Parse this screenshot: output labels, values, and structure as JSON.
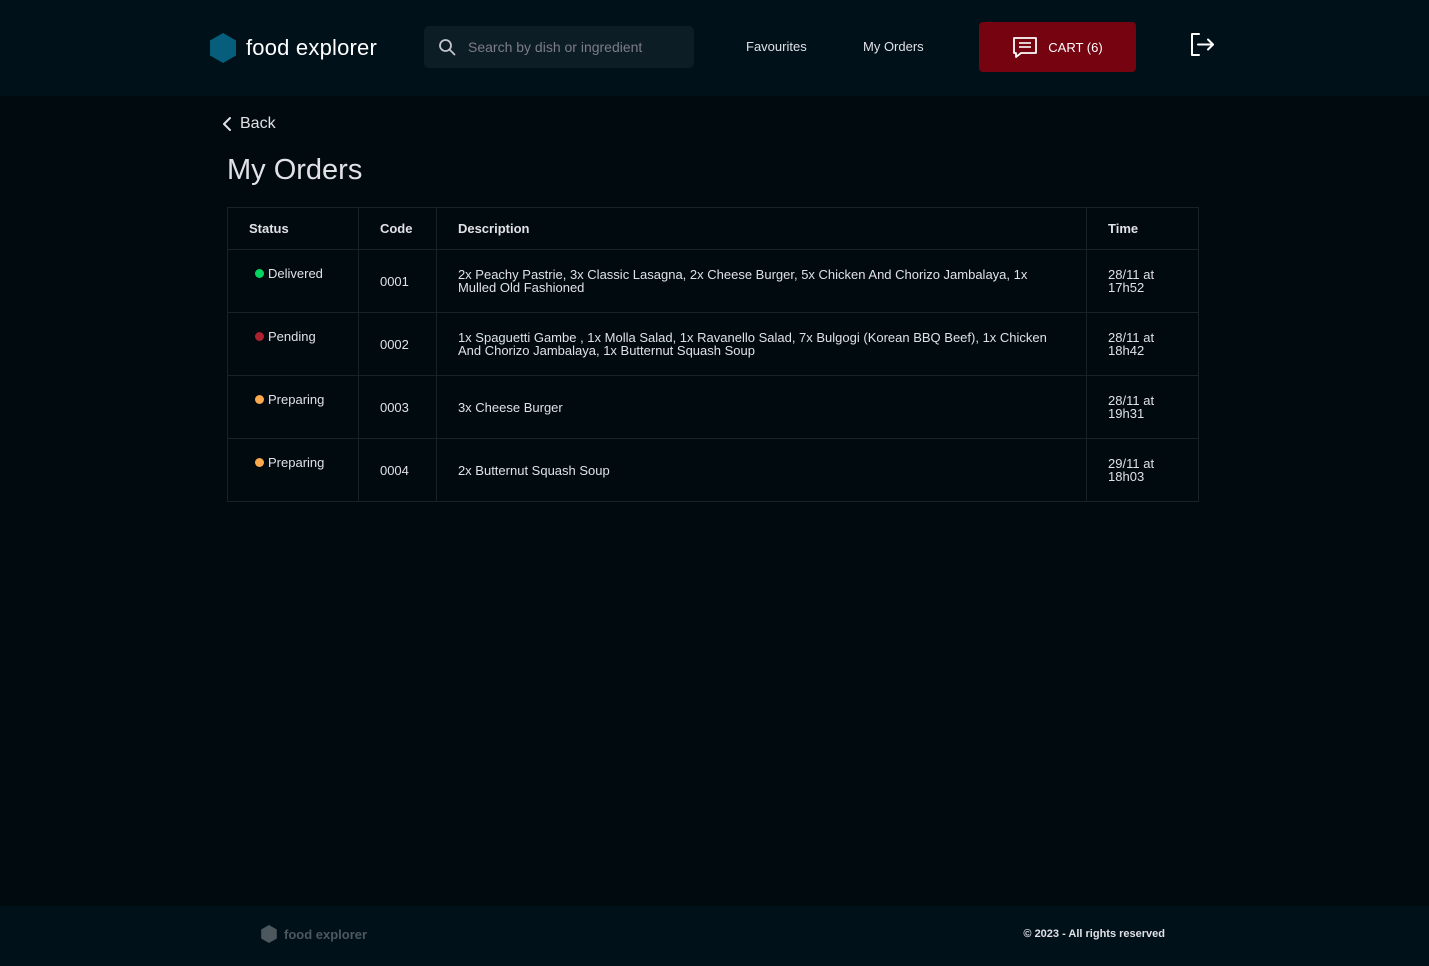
{
  "colors": {
    "accent": "#750310",
    "logo": "#065e7c",
    "delivered": "#04d361",
    "pending": "#ab222e",
    "preparing": "#fba94c"
  },
  "header": {
    "logo_text": "food explorer",
    "search_placeholder": "Search by dish or ingredient",
    "nav": {
      "favourites": "Favourites",
      "my_orders": "My Orders"
    },
    "cart_label": "CART (6)"
  },
  "back_label": "Back",
  "page_title": "My Orders",
  "table": {
    "headers": {
      "status": "Status",
      "code": "Code",
      "description": "Description",
      "time": "Time"
    },
    "rows": [
      {
        "status": "Delivered",
        "status_color": "#04d361",
        "code": "0001",
        "description": "2x Peachy Pastrie, 3x Classic Lasagna, 2x Cheese Burger, 5x Chicken And Chorizo Jambalaya, 1x Mulled Old Fashioned",
        "time": "28/11 at 17h52"
      },
      {
        "status": "Pending",
        "status_color": "#ab222e",
        "code": "0002",
        "description": "1x Spaguetti Gambe , 1x Molla Salad, 1x Ravanello Salad, 7x Bulgogi (Korean BBQ Beef), 1x Chicken And Chorizo Jambalaya, 1x Butternut Squash Soup",
        "time": "28/11 at 18h42"
      },
      {
        "status": "Preparing",
        "status_color": "#fba94c",
        "code": "0003",
        "description": "3x Cheese Burger",
        "time": "28/11 at 19h31"
      },
      {
        "status": "Preparing",
        "status_color": "#fba94c",
        "code": "0004",
        "description": "2x Butternut Squash Soup",
        "time": "29/11 at 18h03"
      }
    ]
  },
  "footer": {
    "logo_text": "food explorer",
    "copyright": "© 2023 - All rights reserved"
  }
}
